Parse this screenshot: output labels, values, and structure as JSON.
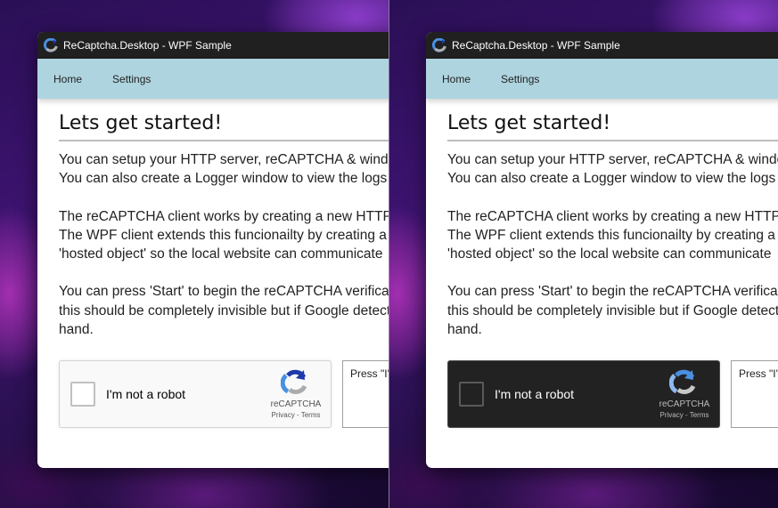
{
  "window": {
    "title": "ReCaptcha.Desktop - WPF Sample"
  },
  "nav": {
    "items": [
      {
        "label": "Home"
      },
      {
        "label": "Settings"
      }
    ]
  },
  "content": {
    "heading": "Lets get started!",
    "paragraphs": [
      {
        "lines": [
          "You can setup your HTTP server, reCAPTCHA & window",
          "You can also create a Logger window to view the logs"
        ]
      },
      {
        "lines": [
          "The reCAPTCHA client works by creating a new HTTP",
          "The WPF client extends this funcionailty by creating a",
          "'hosted object' so the local website can communicate"
        ]
      },
      {
        "lines": [
          "You can press 'Start' to begin the reCAPTCHA verification",
          "this should be completely invisible but if Google detects",
          "hand."
        ]
      }
    ]
  },
  "recaptcha": {
    "checkbox_label": "I'm not a robot",
    "brand": "reCAPTCHA",
    "privacy_label": "Privacy",
    "link_separator": " - ",
    "terms_label": "Terms"
  },
  "output_box": {
    "text": "Press \"I'm"
  },
  "themes": {
    "left": "light",
    "right": "dark"
  },
  "colors": {
    "titlebar": "#202020",
    "navbar": "#aed4df",
    "recaptcha_light_bg": "#f9f9f9",
    "recaptcha_dark_bg": "#222222"
  }
}
